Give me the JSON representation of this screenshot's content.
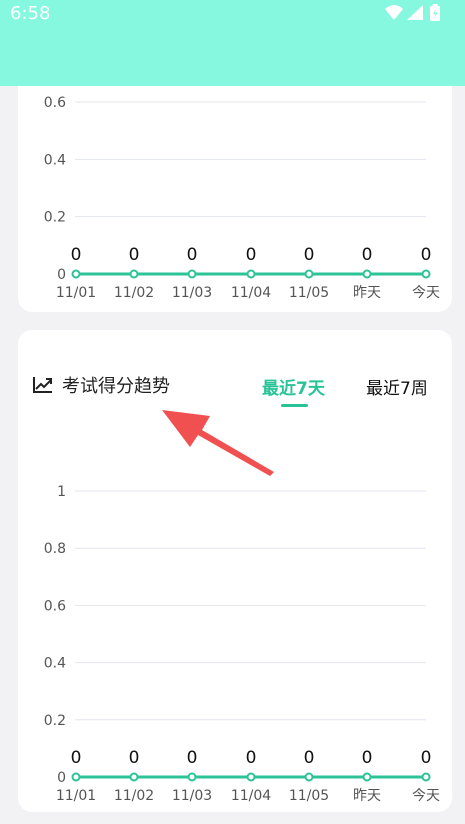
{
  "status_bar": {
    "time": "6:58"
  },
  "charts": [
    {
      "name": "top-chart",
      "y_ticks": [
        "0",
        "0.2",
        "0.4",
        "0.6"
      ],
      "point_values": [
        "0",
        "0",
        "0",
        "0",
        "0",
        "0",
        "0"
      ],
      "x_labels": [
        "11/01",
        "11/02",
        "11/03",
        "11/04",
        "11/05",
        "昨天",
        "今天"
      ]
    },
    {
      "name": "exam-score-chart",
      "y_ticks": [
        "0",
        "0.2",
        "0.4",
        "0.6",
        "0.8",
        "1"
      ],
      "point_values": [
        "0",
        "0",
        "0",
        "0",
        "0",
        "0",
        "0"
      ],
      "x_labels": [
        "11/01",
        "11/02",
        "11/03",
        "11/04",
        "11/05",
        "昨天",
        "今天"
      ]
    }
  ],
  "exam_section": {
    "title": "考试得分趋势",
    "tabs": [
      {
        "label": "最近7天",
        "active": true
      },
      {
        "label": "最近7周",
        "active": false
      }
    ]
  },
  "chart_data": [
    {
      "type": "line",
      "categories": [
        "11/01",
        "11/02",
        "11/03",
        "11/04",
        "11/05",
        "昨天",
        "今天"
      ],
      "series": [
        {
          "values": [
            0,
            0,
            0,
            0,
            0,
            0,
            0
          ]
        }
      ],
      "title": "",
      "xlabel": "",
      "ylabel": "",
      "ylim": [
        0,
        0.6
      ],
      "grid": true,
      "color": "#2cc397"
    },
    {
      "type": "line",
      "categories": [
        "11/01",
        "11/02",
        "11/03",
        "11/04",
        "11/05",
        "昨天",
        "今天"
      ],
      "series": [
        {
          "values": [
            0,
            0,
            0,
            0,
            0,
            0,
            0
          ]
        }
      ],
      "title": "考试得分趋势",
      "xlabel": "",
      "ylabel": "",
      "ylim": [
        0,
        1
      ],
      "grid": true,
      "color": "#2cc397"
    }
  ],
  "colors": {
    "status_bar": "#86f8e0",
    "accent": "#28c397",
    "line": "#2cc397",
    "grid": "#e2e4f0",
    "annotation_arrow": "#f05050"
  }
}
